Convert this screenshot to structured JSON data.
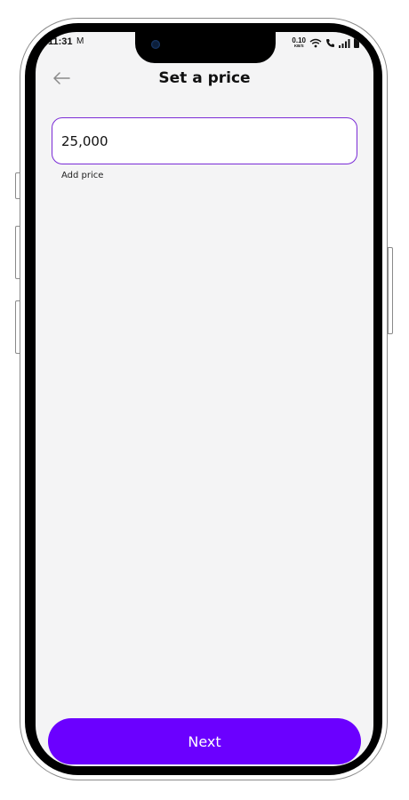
{
  "status_bar": {
    "time": "11:31",
    "mail_glyph": "M",
    "net_speed_value": "0.10",
    "net_speed_unit": "KB/S"
  },
  "header": {
    "title": "Set a price",
    "back_icon": "arrow-left-icon"
  },
  "price_field": {
    "value": "25,000",
    "helper_text": "Add price",
    "border_color": "#7a2bd6"
  },
  "footer": {
    "next_label": "Next",
    "accent_color": "#6b00ff"
  }
}
